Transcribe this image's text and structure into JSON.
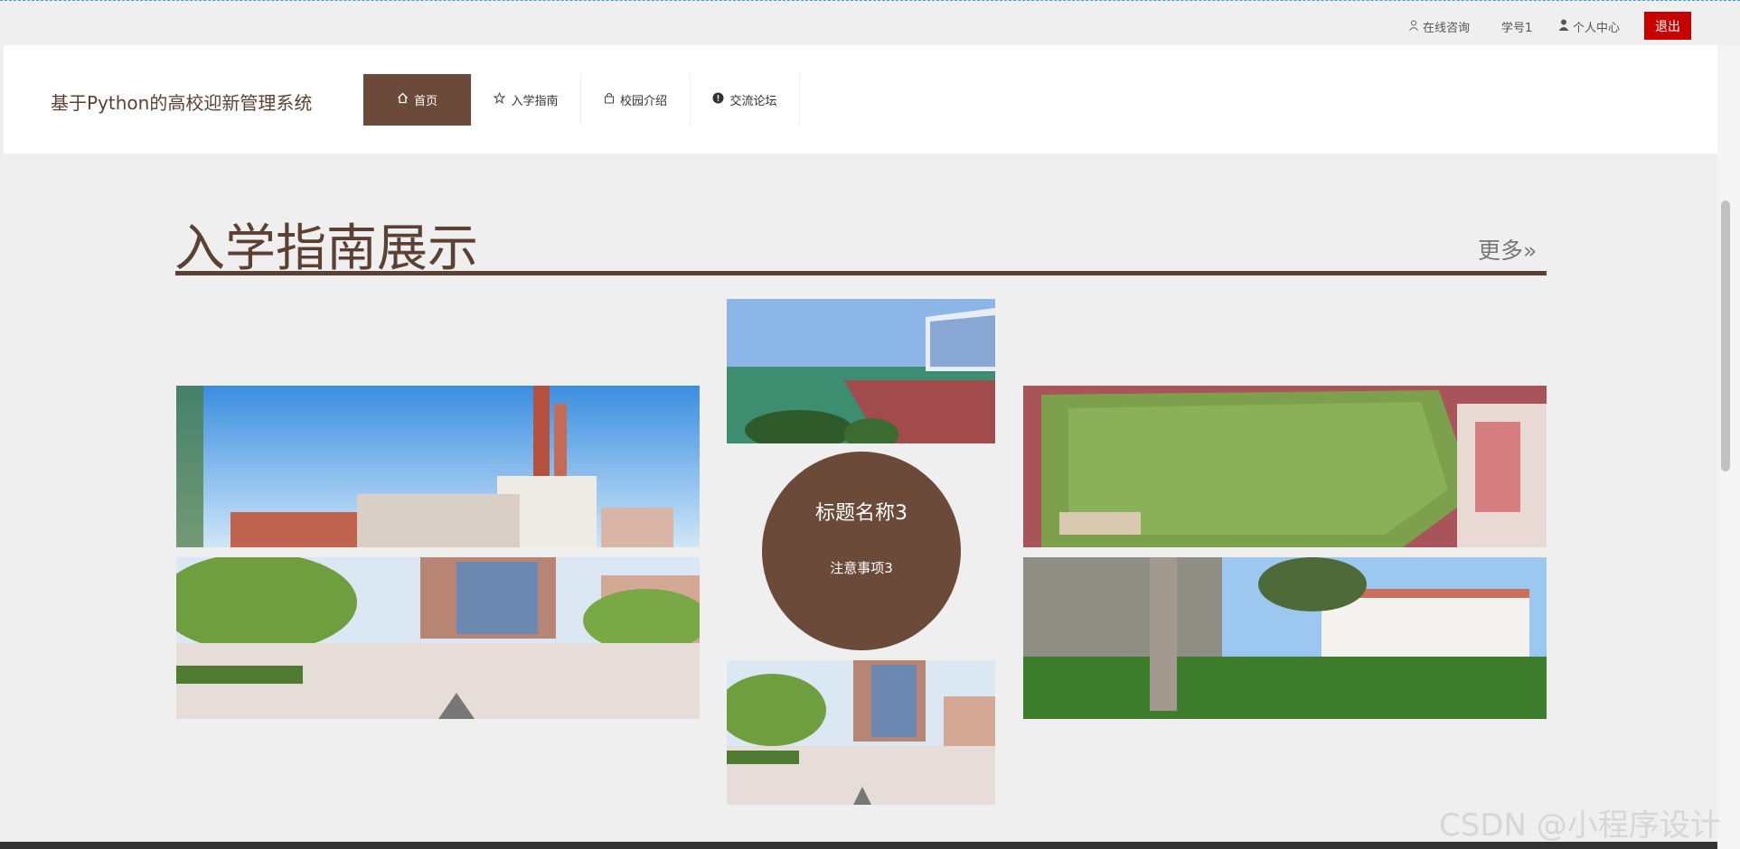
{
  "topbar": {
    "consult": "在线咨询",
    "student_id": "学号1",
    "profile": "个人中心",
    "logout": "退出"
  },
  "header": {
    "site_title": "基于Python的高校迎新管理系统",
    "nav": [
      {
        "label": "首页",
        "icon": "home-icon"
      },
      {
        "label": "入学指南",
        "icon": "star-icon"
      },
      {
        "label": "校园介绍",
        "icon": "bag-icon"
      },
      {
        "label": "交流论坛",
        "icon": "alert-icon"
      }
    ]
  },
  "section": {
    "title": "入学指南展示",
    "more": "更多»"
  },
  "featured": {
    "title": "标题名称3",
    "subtitle": "注意事项3"
  },
  "watermark": "CSDN @小程序设计",
  "colors": {
    "brand": "#6b4a3a",
    "logout": "#c70000"
  }
}
